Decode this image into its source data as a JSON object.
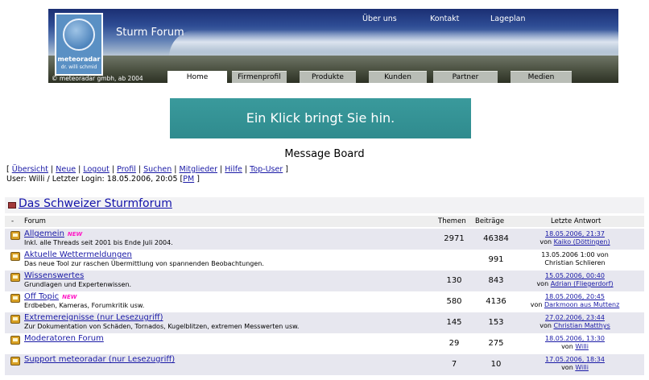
{
  "header": {
    "site_title": "Sturm Forum",
    "logo_name": "meteoradar",
    "logo_sub": "dr. willi schmid",
    "copyright": "© meteoradar gmbh, ab 2004",
    "top_links": [
      "Über uns",
      "Kontakt",
      "Lageplan"
    ],
    "tabs": [
      "Home",
      "Firmenprofil",
      "Produkte",
      "Kunden",
      "Partner",
      "Medien"
    ],
    "active_tab": "Home"
  },
  "banner": {
    "text": "Ein Klick bringt Sie hin."
  },
  "board": {
    "title": "Message Board",
    "links": [
      "Übersicht",
      "Neue",
      "Logout",
      "Profil",
      "Suchen",
      "Mitglieder",
      "Hilfe",
      "Top-User"
    ],
    "user_prefix": "User: Willi / Letzter Login: 18.05.2006, 20:05 [",
    "user_pm": "PM",
    "user_suffix": " ]"
  },
  "section": {
    "title": "Das Schweizer Sturmforum",
    "columns": {
      "toggle": "-",
      "forum": "Forum",
      "themes": "Themen",
      "posts": "Beiträge",
      "last": "Letzte Antwort"
    }
  },
  "forums": [
    {
      "name": "Allgemein",
      "new": true,
      "new_label": "NEW",
      "desc": "Inkl. alle Threads seit 2001 bis Ende Juli 2004.",
      "themes": "2971",
      "posts": "46384",
      "last_date": "18.05.2006, 21:37",
      "last_by_prefix": "von",
      "last_by": "Kaiko (Döttingen)",
      "date_link": true
    },
    {
      "name": "Aktuelle Wettermeldungen",
      "new": false,
      "new_label": "",
      "desc": "Das neue Tool zur raschen Übermittlung von spannenden Beobachtungen.",
      "themes": "",
      "posts": "991",
      "last_date": "13.05.2006 1:00 von",
      "last_by_prefix": "",
      "last_by": "Christian Schlieren",
      "date_link": false
    },
    {
      "name": "Wissenswertes",
      "new": false,
      "new_label": "",
      "desc": "Grundlagen und Expertenwissen.",
      "themes": "130",
      "posts": "843",
      "last_date": "15.05.2006, 00:40",
      "last_by_prefix": "von",
      "last_by": "Adrian (Fliegerdorf)",
      "date_link": true
    },
    {
      "name": "Off Topic",
      "new": true,
      "new_label": "NEW",
      "desc": "Erdbeben, Kameras, Forumkritik usw.",
      "themes": "580",
      "posts": "4136",
      "last_date": "18.05.2006, 20:45",
      "last_by_prefix": "von",
      "last_by": "Darkmoon aus Muttenz",
      "date_link": true
    },
    {
      "name": "Extremereignisse (nur Lesezugriff)",
      "new": false,
      "new_label": "",
      "desc": "Zur Dokumentation von Schäden, Tornados, Kugelblitzen, extremen Messwerten usw.",
      "themes": "145",
      "posts": "153",
      "last_date": "27.02.2006, 23:44",
      "last_by_prefix": "von",
      "last_by": "Christian Matthys",
      "date_link": true
    },
    {
      "name": "Moderatoren Forum",
      "new": false,
      "new_label": "",
      "desc": "",
      "themes": "29",
      "posts": "275",
      "last_date": "18.05.2006, 13:30",
      "last_by_prefix": "von",
      "last_by": "Willi",
      "date_link": true
    },
    {
      "name": "Support meteoradar (nur Lesezugriff)",
      "new": false,
      "new_label": "",
      "desc": "",
      "themes": "7",
      "posts": "10",
      "last_date": "17.05.2006, 18:34",
      "last_by_prefix": "von",
      "last_by": "Willi",
      "date_link": true
    }
  ]
}
